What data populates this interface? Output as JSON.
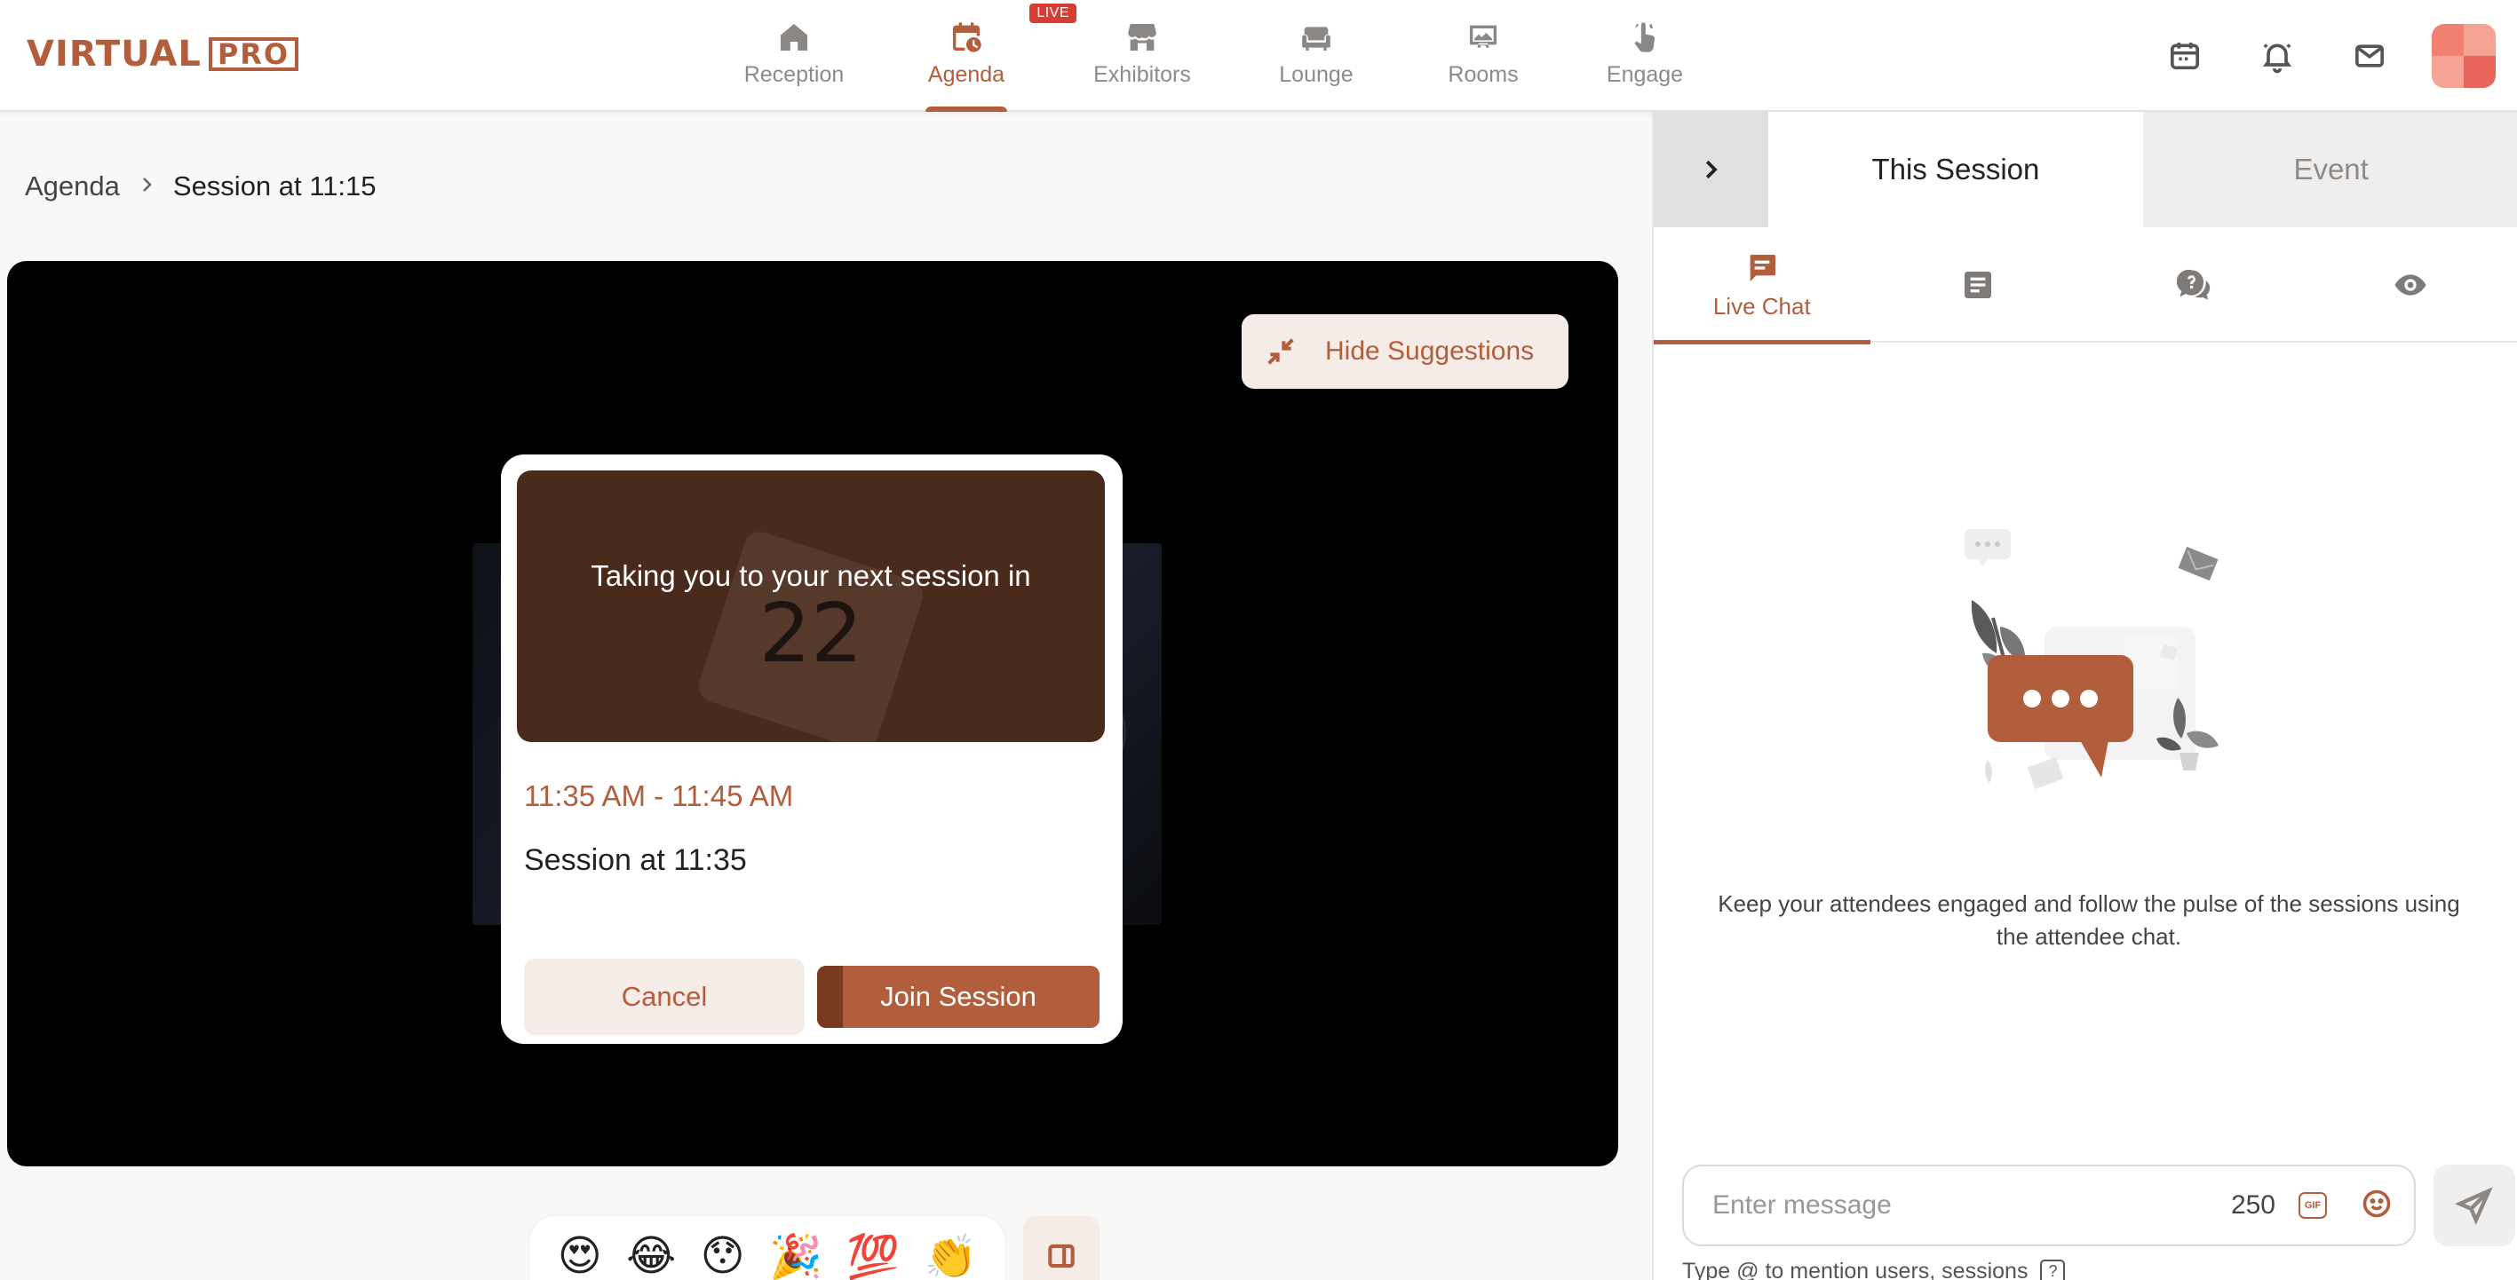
{
  "brand": {
    "logo_word1": "VIRTUAL",
    "logo_word2": "PRO",
    "accent": "#b25d3c",
    "live_badge_color": "#d63b34"
  },
  "nav": {
    "items": [
      {
        "label": "Reception",
        "icon": "home-icon",
        "active": false
      },
      {
        "label": "Agenda",
        "icon": "calendar-clock-icon",
        "active": true,
        "badge": "LIVE"
      },
      {
        "label": "Exhibitors",
        "icon": "storefront-icon",
        "active": false
      },
      {
        "label": "Lounge",
        "icon": "sofa-icon",
        "active": false
      },
      {
        "label": "Rooms",
        "icon": "presentation-icon",
        "active": false
      },
      {
        "label": "Engage",
        "icon": "tap-icon",
        "active": false
      }
    ]
  },
  "top_icons": [
    "calendar-icon",
    "bell-icon",
    "mail-icon"
  ],
  "breadcrumb": {
    "root": "Agenda",
    "current": "Session at 11:15"
  },
  "stage": {
    "hide_suggestions_label": "Hide Suggestions"
  },
  "next_session_modal": {
    "message": "Taking you to your next session in",
    "countdown": "22",
    "time_range": "11:35 AM - 11:45 AM",
    "title": "Session at 11:35",
    "cancel_label": "Cancel",
    "join_label": "Join Session",
    "join_progress": 0.09
  },
  "reactions": [
    "😍",
    "😂",
    "😯",
    "🎉",
    "💯",
    "👏"
  ],
  "panel": {
    "tabs": [
      {
        "label": "This Session",
        "active": true
      },
      {
        "label": "Event",
        "active": false
      }
    ],
    "subtabs": [
      {
        "label": "Live Chat",
        "icon": "chat-icon",
        "active": true
      },
      {
        "label": "",
        "icon": "notes-icon",
        "active": false
      },
      {
        "label": "",
        "icon": "qna-icon",
        "active": false
      },
      {
        "label": "",
        "icon": "eye-icon",
        "active": false
      }
    ],
    "empty_message": "Keep your attendees engaged and follow the pulse of the sessions using the attendee chat.",
    "composer": {
      "placeholder": "Enter message",
      "char_count": "250",
      "gif_label": "GIF",
      "hint": "Type @ to mention users, sessions",
      "hint_help": "?"
    }
  }
}
